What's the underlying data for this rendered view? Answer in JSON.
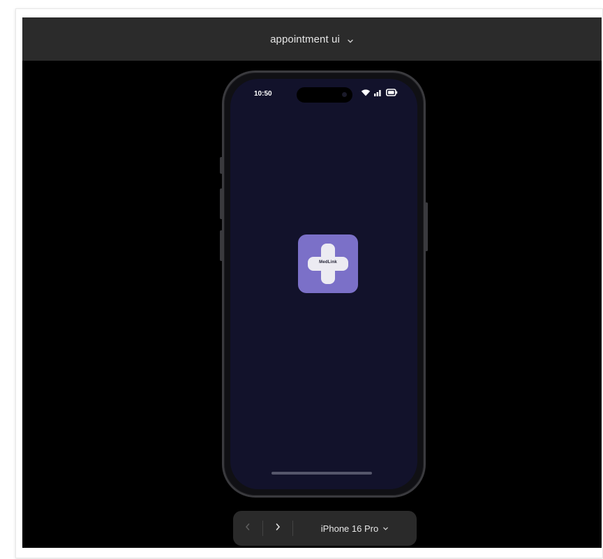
{
  "window": {
    "title": "appointment ui",
    "title_chevron_icon": "chevron-down-icon"
  },
  "phone": {
    "status": {
      "time": "10:50",
      "icons": [
        "wifi-icon",
        "cellular-signal-icon",
        "battery-icon"
      ]
    },
    "app": {
      "icon_name": "medical-cross-icon",
      "icon_label": "MedLink",
      "icon_bg_color": "#7b70c8",
      "screen_bg_color": "#12122b"
    }
  },
  "toolbar": {
    "back_icon": "chevron-left-icon",
    "forward_icon": "chevron-right-icon",
    "device_label": "iPhone 16 Pro",
    "device_chevron_icon": "chevron-down-icon"
  }
}
